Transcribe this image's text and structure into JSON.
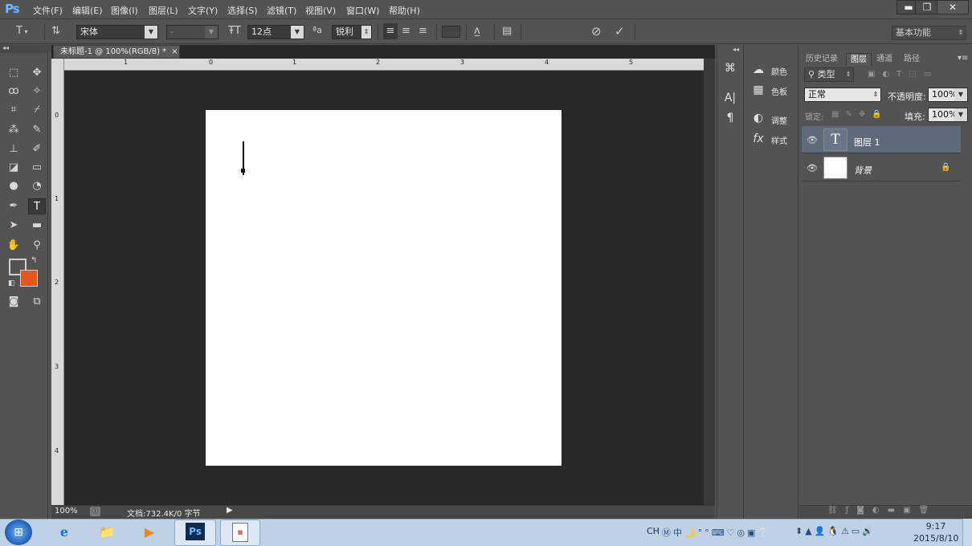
{
  "app": {
    "logo": "Ps"
  },
  "menu": [
    "文件(F)",
    "编辑(E)",
    "图像(I)",
    "图层(L)",
    "文字(Y)",
    "选择(S)",
    "滤镜(T)",
    "视图(V)",
    "窗口(W)",
    "帮助(H)"
  ],
  "window_controls": {
    "minimize": "▬",
    "restore": "❐",
    "close": "✕"
  },
  "options_bar": {
    "font_family": "宋体",
    "font_style": "-",
    "font_size": "12点",
    "antialias_prefix": "a",
    "antialias": "锐利",
    "workspace": "基本功能"
  },
  "document": {
    "tab_title": "未标题-1 @ 100%(RGB/8) *",
    "zoom": "100%",
    "doc_info": "文档:732.4K/0 字节",
    "h_ruler_labels": [
      "1",
      "0",
      "1",
      "2",
      "3",
      "4",
      "5"
    ],
    "v_ruler_labels": [
      "0",
      "1",
      "2",
      "3",
      "4"
    ]
  },
  "colors": {
    "foreground": "#535353",
    "background": "#e8561a",
    "canvas": "#ffffff"
  },
  "mini_panels": [
    {
      "label": "颜色",
      "icon": "palette-icon"
    },
    {
      "label": "色板",
      "icon": "swatches-icon"
    },
    {
      "label": "调整",
      "icon": "adjust-icon"
    },
    {
      "label": "样式",
      "icon": "fx-icon"
    }
  ],
  "layers_panel": {
    "tabs": [
      "历史记录",
      "图层",
      "通道",
      "路径"
    ],
    "active_tab": "图层",
    "filter_label": "类型",
    "blend_mode": "正常",
    "opacity_label": "不透明度:",
    "opacity": "100%",
    "lock_label": "锁定:",
    "fill_label": "填充:",
    "fill": "100%",
    "layers": [
      {
        "name": "图层 1",
        "type": "text",
        "selected": true
      },
      {
        "name": "背景",
        "type": "background",
        "locked": true
      }
    ]
  },
  "taskbar": {
    "lang": "CH",
    "time": "9:17",
    "date": "2015/8/10"
  }
}
